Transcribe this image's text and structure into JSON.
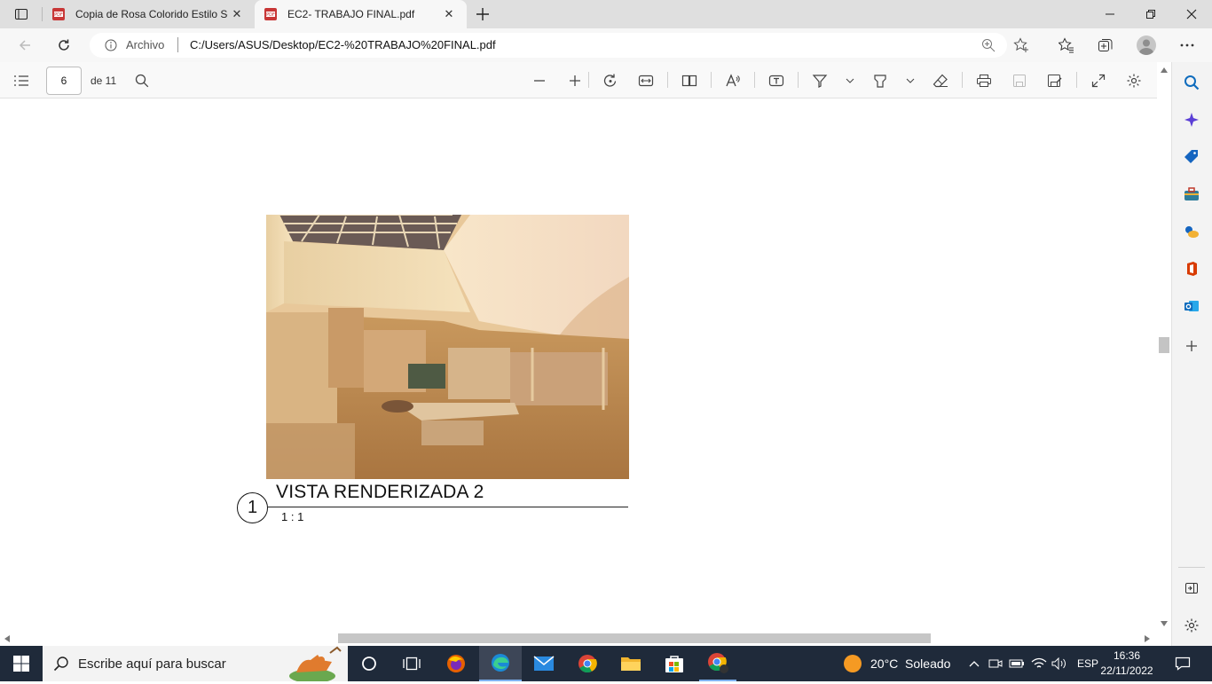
{
  "browser": {
    "tabs": [
      {
        "title": "Copia de Rosa Colorido Estilo Se"
      },
      {
        "title": "EC2- TRABAJO FINAL.pdf"
      }
    ],
    "address": {
      "security_label": "Archivo",
      "url": "C:/Users/ASUS/Desktop/EC2-%20TRABAJO%20FINAL.pdf"
    }
  },
  "pdf": {
    "page_number": "6",
    "page_total": "de 11",
    "drawing_title": "VISTA RENDERIZADA 2",
    "view_number": "1",
    "scale": "1 : 1"
  },
  "taskbar": {
    "search_placeholder": "Escribe aquí para buscar",
    "weather": "20°C  Soleado",
    "language": "ESP",
    "time": "16:36",
    "date": "22/11/2022"
  },
  "colors": {
    "accent": "#0078d4",
    "taskbar": "#1f2a3a"
  }
}
